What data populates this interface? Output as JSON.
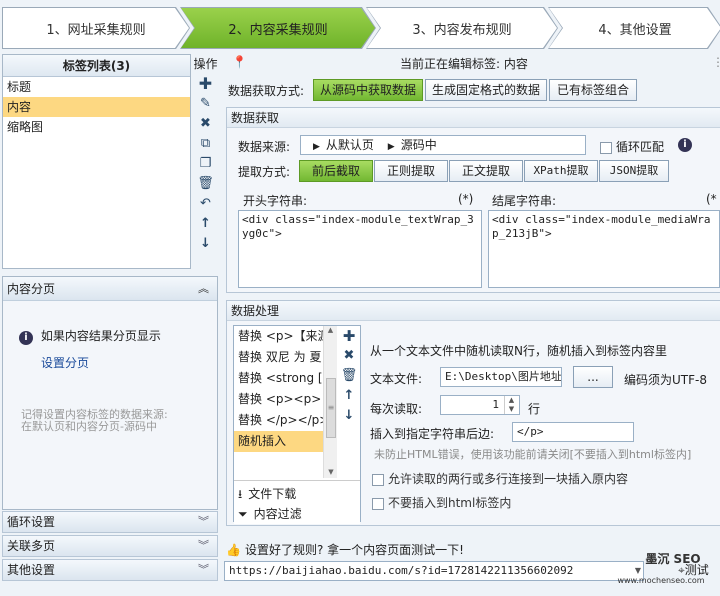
{
  "wizard": {
    "steps": [
      "1、网址采集规则",
      "2、内容采集规则",
      "3、内容发布规则",
      "4、其他设置"
    ],
    "active_index": 1
  },
  "tag_list": {
    "title": "标签列表(3)",
    "items": [
      "标题",
      "内容",
      "缩略图"
    ],
    "selected_index": 1,
    "ops_label": "操作"
  },
  "content_paging": {
    "header": "内容分页",
    "info": "如果内容结果分页显示",
    "link": "设置分页",
    "note_line1": "记得设置内容标签的数据来源:",
    "note_line2": "在默认页和内容分页-源码中"
  },
  "accordion": [
    "循环设置",
    "关联多页",
    "其他设置"
  ],
  "current_tag": "当前正在编辑标签: 内容",
  "fetch_mode": {
    "label": "数据获取方式:",
    "options": [
      "从源码中获取数据",
      "生成固定格式的数据",
      "已有标签组合"
    ],
    "selected_index": 0
  },
  "data_fetch": {
    "title": "数据获取",
    "source_label": "数据来源:",
    "source_parts": [
      "从默认页",
      "源码中"
    ],
    "loop_label": "循环匹配",
    "extract_label": "提取方式:",
    "extract_options": [
      "前后截取",
      "正则提取",
      "正文提取",
      "XPath提取",
      "JSON提取"
    ],
    "extract_selected": 0,
    "start_label": "开头字符串:",
    "start_star": "(*)",
    "start_value": "<div class=\"index-module_textWrap_3yg0c\">",
    "end_label": "结尾字符串:",
    "end_star": "(*",
    "end_value": "<div class=\"index-module_mediaWrap_213jB\">"
  },
  "processing": {
    "title": "数据处理",
    "items": [
      "替换 <p>【来源",
      "替换 双尼 为 夏",
      "替换 <strong [",
      "替换 <p><p> 为",
      "替换 </p></p>",
      "随机插入"
    ],
    "selected_index": 5,
    "footer": [
      "文件下载",
      "内容过滤"
    ],
    "desc": "从一个文本文件中随机读取N行，随机插入到标签内容里",
    "file_label": "文本文件:",
    "file_value": "E:\\Desktop\\图片地址:",
    "browse": "...",
    "encoding_note": "编码须为UTF-8",
    "read_label": "每次读取:",
    "read_value": "1",
    "read_unit": "行",
    "insert_after_label": "插入到指定字符串后边:",
    "insert_after_value": "</p>",
    "warn": "未防止HTML错误，使用该功能前请关闭[不要插入到html标签内]",
    "opt1": "允许读取的两行或多行连接到一块插入原内容",
    "opt2": "不要插入到html标签内"
  },
  "test": {
    "prompt": "设置好了规则? 拿一个内容页面测试一下!",
    "url": "https://baijiahao.baidu.com/s?id=1728142211356602092",
    "button": "测试"
  },
  "watermark": {
    "line1": "墨沉 SEO",
    "line2": "www.mochenseo.com"
  }
}
